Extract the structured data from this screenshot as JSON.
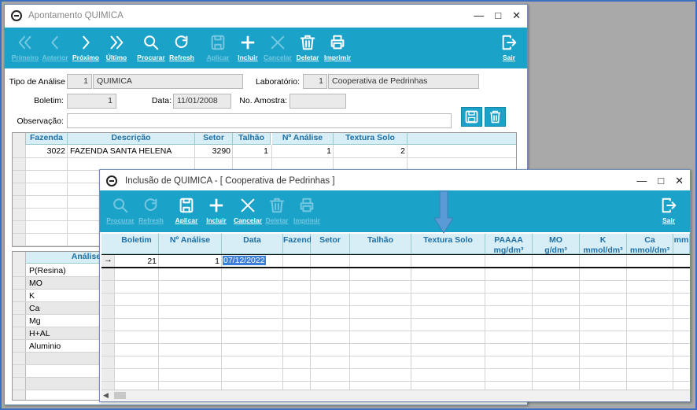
{
  "win1": {
    "title": "Apontamento QUIMICA",
    "toolbar": [
      {
        "label": "Primeiro",
        "icon": "first-icon",
        "enabled": false
      },
      {
        "label": "Anterior",
        "icon": "previous-icon",
        "enabled": false
      },
      {
        "label": "Próximo",
        "icon": "next-icon",
        "enabled": true
      },
      {
        "label": "Último",
        "icon": "last-icon",
        "enabled": true
      },
      {
        "label": "Procurar",
        "icon": "search-icon",
        "enabled": true
      },
      {
        "label": "Refresh",
        "icon": "refresh-icon",
        "enabled": true
      },
      {
        "label": "Aplicar",
        "icon": "save-icon",
        "enabled": false
      },
      {
        "label": "Incluir",
        "icon": "plus-icon",
        "enabled": true
      },
      {
        "label": "Cancelar",
        "icon": "cancel-icon",
        "enabled": false
      },
      {
        "label": "Deletar",
        "icon": "trash-icon",
        "enabled": true
      },
      {
        "label": "Imprimir",
        "icon": "printer-icon",
        "enabled": true
      },
      {
        "label": "Sair",
        "icon": "exit-icon",
        "enabled": true
      }
    ],
    "form": {
      "tipo_label": "Tipo de Análise",
      "tipo_code": "1",
      "tipo_value": "QUIMICA",
      "lab_label": "Laboratório:",
      "lab_code": "1",
      "lab_value": "Cooperativa de Pedrinhas",
      "boletim_label": "Boletim:",
      "boletim_value": "1",
      "data_label": "Data:",
      "data_value": "11/01/2008",
      "amostra_label": "No. Amostra:",
      "amostra_value": "",
      "obs_label": "Observação:",
      "obs_value": ""
    },
    "grid": {
      "headers": [
        "Fazenda",
        "Descrição",
        "Setor",
        "Talhão",
        "Nº Análise",
        "Textura Solo"
      ],
      "rows": [
        [
          "3022",
          "FAZENDA SANTA HELENA",
          "3290",
          "1",
          "1",
          "2"
        ]
      ]
    },
    "analises": {
      "header": "Análises",
      "items": [
        "P(Resina)",
        "MO",
        "K",
        "Ca",
        "Mg",
        "H+AL",
        "Aluminio"
      ]
    }
  },
  "win2": {
    "title": "Inclusão de QUIMICA - [ Cooperativa de Pedrinhas ]",
    "toolbar": [
      {
        "label": "Procurar",
        "icon": "search-icon",
        "enabled": false
      },
      {
        "label": "Refresh",
        "icon": "refresh-icon",
        "enabled": false
      },
      {
        "label": "Aplicar",
        "icon": "save-icon",
        "enabled": true
      },
      {
        "label": "Incluir",
        "icon": "plus-icon",
        "enabled": true
      },
      {
        "label": "Cancelar",
        "icon": "cancel-icon",
        "enabled": true
      },
      {
        "label": "Deletar",
        "icon": "trash-icon",
        "enabled": false
      },
      {
        "label": "Imprimir",
        "icon": "printer-icon",
        "enabled": false
      },
      {
        "label": "Sair",
        "icon": "exit-icon",
        "enabled": true
      }
    ],
    "grid": {
      "headers": [
        "Boletim",
        "Nº Análise",
        "Data",
        "Fazenda",
        "Setor",
        "Talhão",
        "Textura Solo",
        "PAAAA\nmg/dm³",
        "MO\ng/dm³",
        "K\nmmol/dm³",
        "Ca\nmmol/dm³",
        "mm"
      ],
      "row": {
        "boletim": "21",
        "analise": "1",
        "data": "07/12/2022"
      }
    }
  },
  "colors": {
    "toolbar": "#1aa2c9",
    "header_bg": "#d8eef6",
    "header_text": "#1e6fa6",
    "arrow": "#5b9bd5"
  }
}
